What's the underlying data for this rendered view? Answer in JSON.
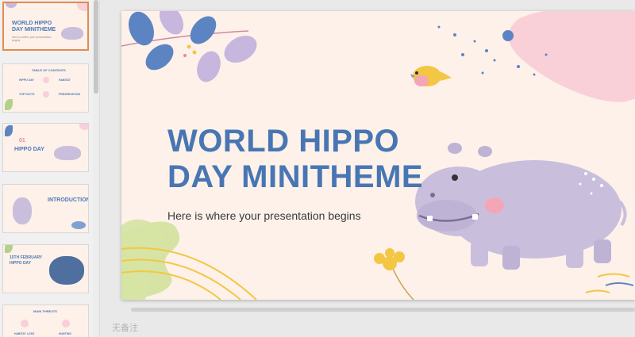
{
  "slides": {
    "s1": {
      "title_line1": "WORLD HIPPO",
      "title_line2": "DAY MINITHEME",
      "subtitle": "Here is where your presentation begins"
    },
    "s2": {
      "title": "TABLE OF CONTENTS",
      "items": [
        "HIPPO DAY",
        "HABITAT",
        "TOP FACTS",
        "PRESERVATION"
      ]
    },
    "s3": {
      "number": "01",
      "title": "HIPPO DAY"
    },
    "s4": {
      "title": "INTRODUCTION"
    },
    "s5": {
      "title_line1": "15TH FEBRUARY",
      "title_line2": "HIPPO DAY"
    },
    "s6": {
      "title": "MAIN THREATS",
      "items": [
        "HABITAT LOSS",
        "HUNTING"
      ]
    }
  },
  "main_slide": {
    "title_line1": "WORLD HIPPO",
    "title_line2": "DAY MINITHEME",
    "subtitle": "Here is where your presentation begins"
  },
  "notes_placeholder": "无备注",
  "colors": {
    "title_blue": "#4876b3",
    "slide_bg": "#fdf1ea",
    "hippo": "#c9bfdc",
    "accent_pink": "#f9cfd8",
    "active_border": "#e58a4d"
  }
}
